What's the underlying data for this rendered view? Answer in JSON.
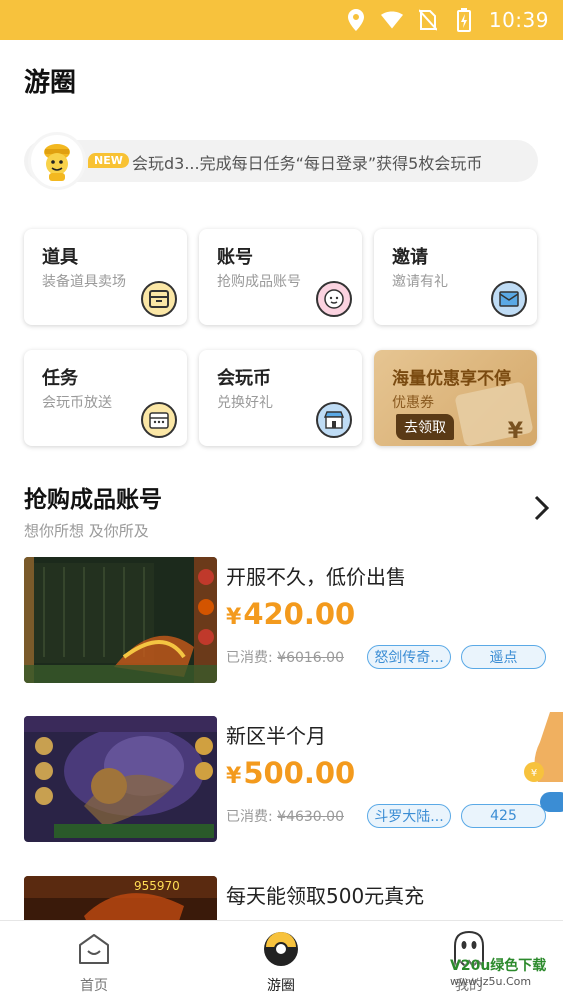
{
  "status_bar": {
    "time": "10:39",
    "icons": [
      "location-icon",
      "wifi-icon",
      "no-sim-icon",
      "battery-charging-icon"
    ]
  },
  "header": {
    "title": "游圈"
  },
  "notice": {
    "badge": "NEW",
    "text": "会玩d3...完成每日任务“每日登录”获得5枚会玩币"
  },
  "cards": [
    {
      "title": "道具",
      "subtitle": "装备道具卖场",
      "icon": "shop-icon"
    },
    {
      "title": "账号",
      "subtitle": "抢购成品账号",
      "icon": "face-icon"
    },
    {
      "title": "邀请",
      "subtitle": "邀请有礼",
      "icon": "envelope-icon"
    },
    {
      "title": "任务",
      "subtitle": "会玩币放送",
      "icon": "calendar-icon"
    },
    {
      "title": "会玩币",
      "subtitle": "兑换好礼",
      "icon": "store-icon"
    }
  ],
  "promo": {
    "title": "海量优惠享不停",
    "subtitle": "优惠券",
    "button": "去领取",
    "symbol": "¥"
  },
  "section": {
    "title": "抢购成品账号",
    "subtitle": "想你所想  及你所及"
  },
  "listings": [
    {
      "title": "开服不久，低价出售",
      "currency": "¥",
      "price": "420.00",
      "spent_label": "已消费:",
      "spent_value": "¥6016.00",
      "tags": [
        "怒剑传奇...",
        "遥点"
      ]
    },
    {
      "title": "新区半个月",
      "currency": "¥",
      "price": "500.00",
      "spent_label": "已消费:",
      "spent_value": "¥4630.00",
      "tags": [
        "斗罗大陆...",
        "425"
      ]
    },
    {
      "title": "每天能领取500元真充",
      "currency": "",
      "price": "",
      "spent_label": "",
      "spent_value": "",
      "tags": []
    }
  ],
  "thumb_texts": {
    "third": "955970"
  },
  "tabbar": {
    "items": [
      {
        "label": "首页",
        "icon": "home-icon"
      },
      {
        "label": "游圈",
        "icon": "circle-icon"
      },
      {
        "label": "我的",
        "icon": "ghost-icon"
      }
    ]
  },
  "watermark": {
    "line1": "V20u绿色下载",
    "line2": "www.Jz5u.Com"
  },
  "colors": {
    "accent": "#f7c23d",
    "price": "#f39a1d",
    "tag": "#3b8dd4"
  }
}
